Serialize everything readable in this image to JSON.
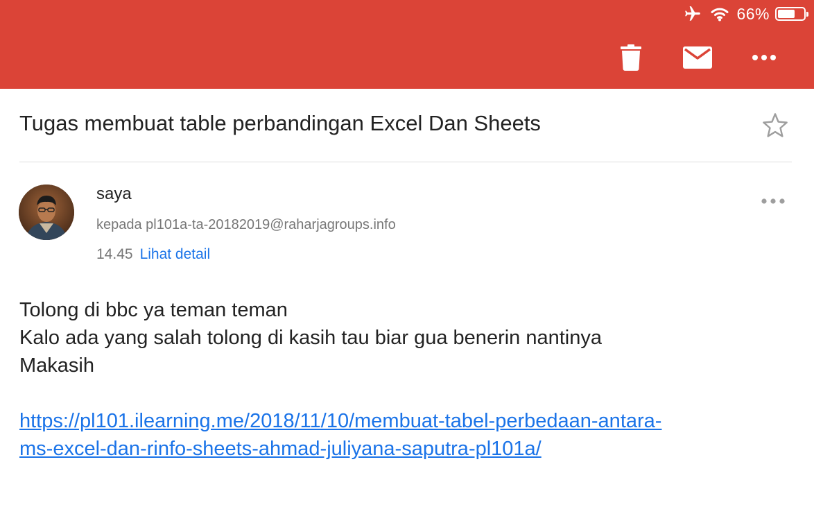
{
  "status_bar": {
    "battery_percent_label": "66%",
    "battery_level": 0.66,
    "icons": [
      "airplane-icon",
      "wifi-icon",
      "battery-icon"
    ]
  },
  "toolbar": {
    "actions": [
      "trash-icon",
      "mail-icon",
      "more-horizontal-icon"
    ]
  },
  "email": {
    "subject": "Tugas membuat table perbandingan Excel Dan Sheets",
    "sender": "saya",
    "recipient": "kepada pl101a-ta-20182019@raharjagroups.info",
    "time": "14.45",
    "detail_link": "Lihat detail",
    "body_lines": [
      "Tolong di bbc ya teman teman",
      "Kalo ada yang salah tolong di kasih tau biar gua benerin nantinya",
      "Makasih"
    ],
    "link_lines": [
      "https://pl101.ilearning.me/2018/11/10/membuat-tabel-perbedaan-antara-",
      "ms-excel-dan-rinfo-sheets-ahmad-juliyana-saputra-pl101a/"
    ]
  },
  "colors": {
    "header": "#db4437",
    "link": "#1a73e8",
    "text": "#222222",
    "muted": "#777777"
  }
}
